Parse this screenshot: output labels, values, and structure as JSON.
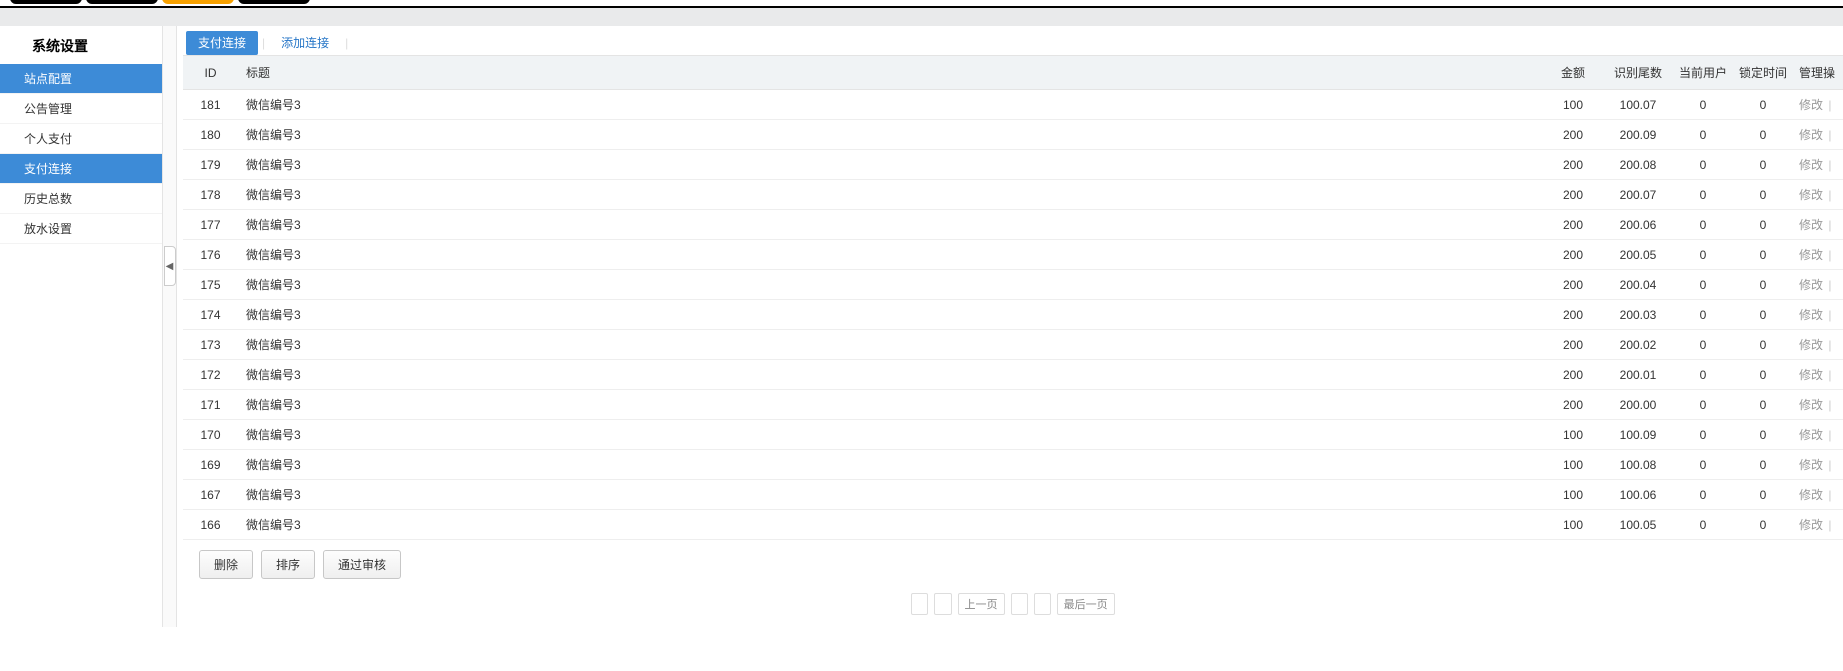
{
  "sidebar": {
    "title": "系统设置",
    "items": [
      {
        "label": "站点配置",
        "active": true
      },
      {
        "label": "公告管理",
        "active": false
      },
      {
        "label": "个人支付",
        "active": false
      },
      {
        "label": "支付连接",
        "active": true
      },
      {
        "label": "历史总数",
        "active": false
      },
      {
        "label": "放水设置",
        "active": false
      }
    ]
  },
  "tabs": {
    "items": [
      {
        "label": "支付连接",
        "active": true
      },
      {
        "label": "添加连接",
        "active": false
      }
    ]
  },
  "table": {
    "headers": {
      "id": "ID",
      "title": "标题",
      "amount": "金额",
      "tail": "识别尾数",
      "user": "当前用户",
      "lock": "锁定时间",
      "ops": "管理操"
    },
    "op_edit": "修改",
    "rows": [
      {
        "id": "181",
        "title": "微信编号3",
        "amount": "100",
        "tail": "100.07",
        "user": "0",
        "lock": "0"
      },
      {
        "id": "180",
        "title": "微信编号3",
        "amount": "200",
        "tail": "200.09",
        "user": "0",
        "lock": "0"
      },
      {
        "id": "179",
        "title": "微信编号3",
        "amount": "200",
        "tail": "200.08",
        "user": "0",
        "lock": "0"
      },
      {
        "id": "178",
        "title": "微信编号3",
        "amount": "200",
        "tail": "200.07",
        "user": "0",
        "lock": "0"
      },
      {
        "id": "177",
        "title": "微信编号3",
        "amount": "200",
        "tail": "200.06",
        "user": "0",
        "lock": "0"
      },
      {
        "id": "176",
        "title": "微信编号3",
        "amount": "200",
        "tail": "200.05",
        "user": "0",
        "lock": "0"
      },
      {
        "id": "175",
        "title": "微信编号3",
        "amount": "200",
        "tail": "200.04",
        "user": "0",
        "lock": "0"
      },
      {
        "id": "174",
        "title": "微信编号3",
        "amount": "200",
        "tail": "200.03",
        "user": "0",
        "lock": "0"
      },
      {
        "id": "173",
        "title": "微信编号3",
        "amount": "200",
        "tail": "200.02",
        "user": "0",
        "lock": "0"
      },
      {
        "id": "172",
        "title": "微信编号3",
        "amount": "200",
        "tail": "200.01",
        "user": "0",
        "lock": "0"
      },
      {
        "id": "171",
        "title": "微信编号3",
        "amount": "200",
        "tail": "200.00",
        "user": "0",
        "lock": "0"
      },
      {
        "id": "170",
        "title": "微信编号3",
        "amount": "100",
        "tail": "100.09",
        "user": "0",
        "lock": "0"
      },
      {
        "id": "169",
        "title": "微信编号3",
        "amount": "100",
        "tail": "100.08",
        "user": "0",
        "lock": "0"
      },
      {
        "id": "167",
        "title": "微信编号3",
        "amount": "100",
        "tail": "100.06",
        "user": "0",
        "lock": "0"
      },
      {
        "id": "166",
        "title": "微信编号3",
        "amount": "100",
        "tail": "100.05",
        "user": "0",
        "lock": "0"
      }
    ]
  },
  "footer": {
    "delete": "删除",
    "sort": "排序",
    "approve": "通过审核"
  },
  "pager": {
    "prev": "上一页",
    "next": "最后一页"
  }
}
